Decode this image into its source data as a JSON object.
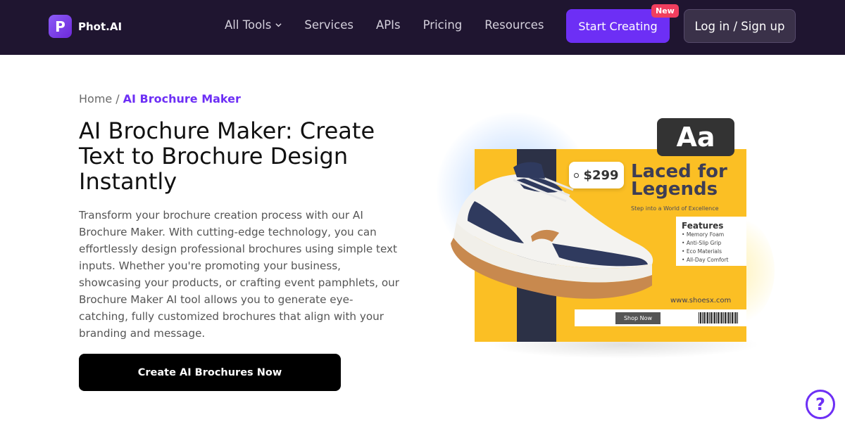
{
  "nav": {
    "logo_letter": "P",
    "logo_text": "Phot.AI",
    "links": [
      {
        "label": "All Tools",
        "has_dropdown": true
      },
      {
        "label": "Services"
      },
      {
        "label": "APIs"
      },
      {
        "label": "Pricing"
      },
      {
        "label": "Resources"
      }
    ],
    "start_label": "Start Creating",
    "new_badge": "New",
    "login_label": "Log in / Sign up"
  },
  "breadcrumb": {
    "home": "Home",
    "separator": "/",
    "current": "AI Brochure Maker"
  },
  "hero": {
    "title": "AI Brochure Maker: Create Text to Brochure Design Instantly",
    "description": "Transform your brochure creation process with our AI Brochure Maker. With cutting-edge technology, you can effortlessly design professional brochures using simple text inputs. Whether you're promoting your business, showcasing your products, or crafting event pamphlets, our Brochure Maker AI tool allows you to generate eye-catching, fully customized brochures that align with your branding and message.",
    "cta_label": "Create AI Brochures Now"
  },
  "showcase": {
    "aa_chip": "Aa",
    "price": "$299",
    "headline_line1": "Laced for",
    "headline_line2": "Legends",
    "tagline": "Step into a World of Excellence",
    "features_title": "Features",
    "features": [
      "Memory Foam",
      "Anti-Slip Grip",
      "Eco Materials",
      "All-Day Comfort"
    ],
    "website": "www.shoesx.com",
    "shop_now": "Shop Now"
  },
  "help": {
    "label": "?"
  },
  "colors": {
    "nav_bg": "#1f1530",
    "accent": "#6d2ff5",
    "badge": "#f03e5e",
    "poster_yellow": "#fbbf24",
    "poster_navy": "#2c3146"
  }
}
